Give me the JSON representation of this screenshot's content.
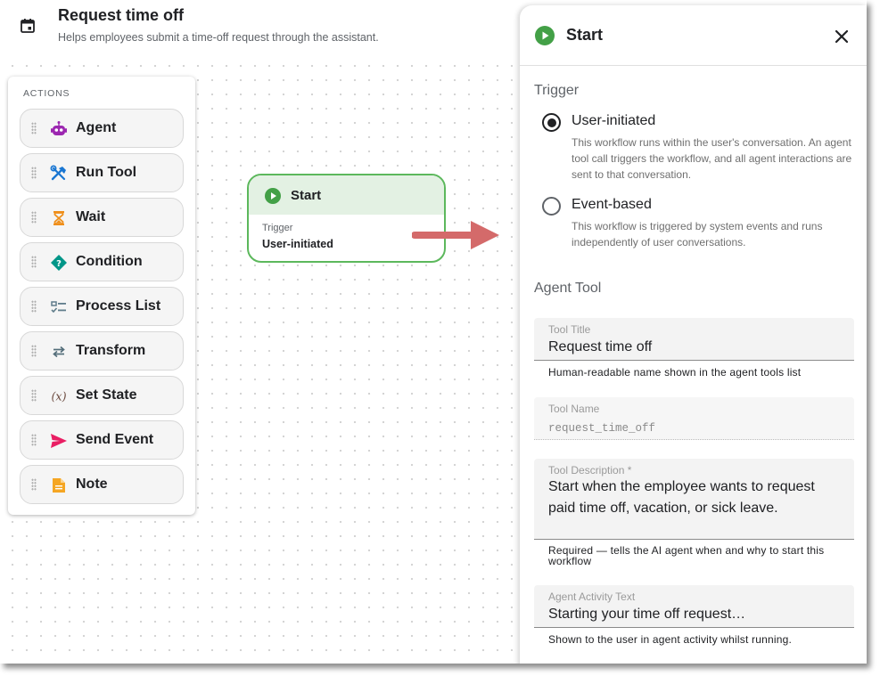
{
  "header": {
    "title": "Request time off",
    "subtitle": "Helps employees submit a time-off request through the assistant.",
    "icon": "calendar-icon"
  },
  "palette": {
    "label": "ACTIONS",
    "items": [
      {
        "label": "Agent",
        "icon": "robot-icon",
        "color": "#9c27b0"
      },
      {
        "label": "Run Tool",
        "icon": "tools-icon",
        "color": "#1976d2"
      },
      {
        "label": "Wait",
        "icon": "hourglass-icon",
        "color": "#ef8f1a"
      },
      {
        "label": "Condition",
        "icon": "diamond-question-icon",
        "color": "#009688"
      },
      {
        "label": "Process List",
        "icon": "checklist-icon",
        "color": "#607d8b"
      },
      {
        "label": "Transform",
        "icon": "swap-arrows-icon",
        "color": "#546e7a"
      },
      {
        "label": "Set State",
        "icon": "variable-icon",
        "color": "#6d4c41"
      },
      {
        "label": "Send Event",
        "icon": "send-icon",
        "color": "#e91e63"
      },
      {
        "label": "Note",
        "icon": "note-icon",
        "color": "#f5a623"
      }
    ]
  },
  "node": {
    "title": "Start",
    "trigger_label": "Trigger",
    "trigger_value": "User-initiated"
  },
  "panel": {
    "title": "Start",
    "trigger_section": "Trigger",
    "options": [
      {
        "label": "User-initiated",
        "selected": true,
        "description": "This workflow runs within the user's conversation. An agent tool call triggers the workflow, and all agent interactions are sent to that conversation."
      },
      {
        "label": "Event-based",
        "selected": false,
        "description": "This workflow is triggered by system events and runs independently of user conversations."
      }
    ],
    "agent_tool_section": "Agent Tool",
    "fields": {
      "tool_title": {
        "label": "Tool Title",
        "value": "Request time off",
        "helper": "Human-readable name shown in the agent tools list"
      },
      "tool_name": {
        "label": "Tool Name",
        "value": "request_time_off"
      },
      "tool_description": {
        "label": "Tool Description *",
        "value": "Start when the employee wants to request paid time off, vacation, or sick leave.",
        "helper": "Required — tells the AI agent when and why to start this workflow"
      },
      "agent_activity": {
        "label": "Agent Activity Text",
        "value": "Starting your time off request…",
        "helper": "Shown to the user in agent activity whilst running."
      }
    },
    "accent": "#43a047"
  }
}
